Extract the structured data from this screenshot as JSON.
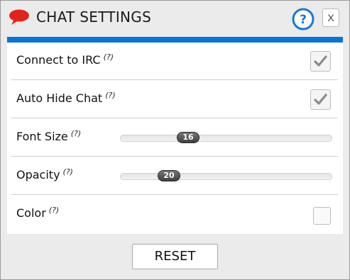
{
  "titlebar": {
    "title": "CHAT SETTINGS",
    "title_icon": "speech-bubble-icon",
    "help_icon": "question-circle-icon",
    "close_label": "X"
  },
  "colors": {
    "accent": "#0a74d6",
    "bubble": "#e0241b",
    "help": "#1877d8",
    "dialog_background": "#ebebeb",
    "panel_background": "#ffffff"
  },
  "settings": {
    "help_hint": "(?)",
    "connect_irc": {
      "label": "Connect to IRC",
      "checked": true
    },
    "auto_hide": {
      "label": "Auto Hide Chat",
      "checked": true
    },
    "font_size": {
      "label": "Font Size",
      "value": "16",
      "fraction": 0.3
    },
    "opacity": {
      "label": "Opacity",
      "value": "20",
      "fraction": 0.2
    },
    "color": {
      "label": "Color",
      "checked": false
    }
  },
  "footer": {
    "reset_label": "RESET"
  }
}
